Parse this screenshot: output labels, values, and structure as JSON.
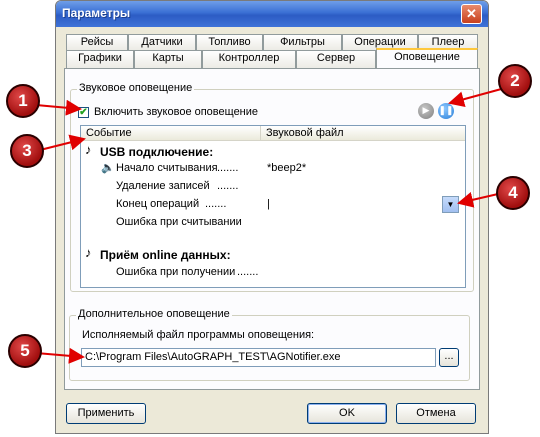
{
  "window": {
    "title": "Параметры",
    "close_glyph": "✕"
  },
  "tabs_row1": [
    "Рейсы",
    "Датчики",
    "Топливо",
    "Фильтры",
    "Операции",
    "Плеер"
  ],
  "tabs_row2": [
    "Графики",
    "Карты",
    "Контроллер",
    "Сервер",
    "Оповещение"
  ],
  "sound_group": {
    "title": "Звуковое оповещение",
    "enable_checkbox_label": "Включить звуковое оповещение",
    "enable_checked": true,
    "play_icon": "play-icon",
    "pause_icon": "pause-icon",
    "columns": [
      "Событие",
      "Звуковой файл"
    ],
    "sections": [
      {
        "title": "USB подключение:",
        "icon": "music-note-icon",
        "rows": [
          {
            "event": "Начало считывания",
            "file": "*beep2*",
            "has_speaker": true
          },
          {
            "event": "Удаление записей",
            "file": "",
            "has_speaker": false
          },
          {
            "event": "Конец операций",
            "file": "|",
            "has_speaker": false
          },
          {
            "event": "Ошибка при считывании",
            "file": "",
            "has_speaker": false
          }
        ]
      },
      {
        "title": "Приём online данных:",
        "icon": "music-note-icon",
        "rows": [
          {
            "event": "Ошибка при получении",
            "file": "",
            "has_speaker": false
          }
        ]
      }
    ],
    "dots": ".......",
    "dropdown_glyph": "▼"
  },
  "extra_group": {
    "title": "Дополнительное оповещение",
    "exe_label": "Исполняемый файл программы оповещения:",
    "exe_path": "C:\\Program Files\\AutoGRAPH_TEST\\AGNotifier.exe",
    "browse_label": "..."
  },
  "buttons": {
    "apply": "Применить",
    "ok": "OK",
    "cancel": "Отмена"
  },
  "callouts": [
    "1",
    "2",
    "3",
    "4",
    "5"
  ],
  "colors": {
    "callout_red": "#c01818",
    "arrow_red": "#e00000",
    "title_blue": "#2c5cc4",
    "active_tab_accent": "#ffc83c"
  }
}
